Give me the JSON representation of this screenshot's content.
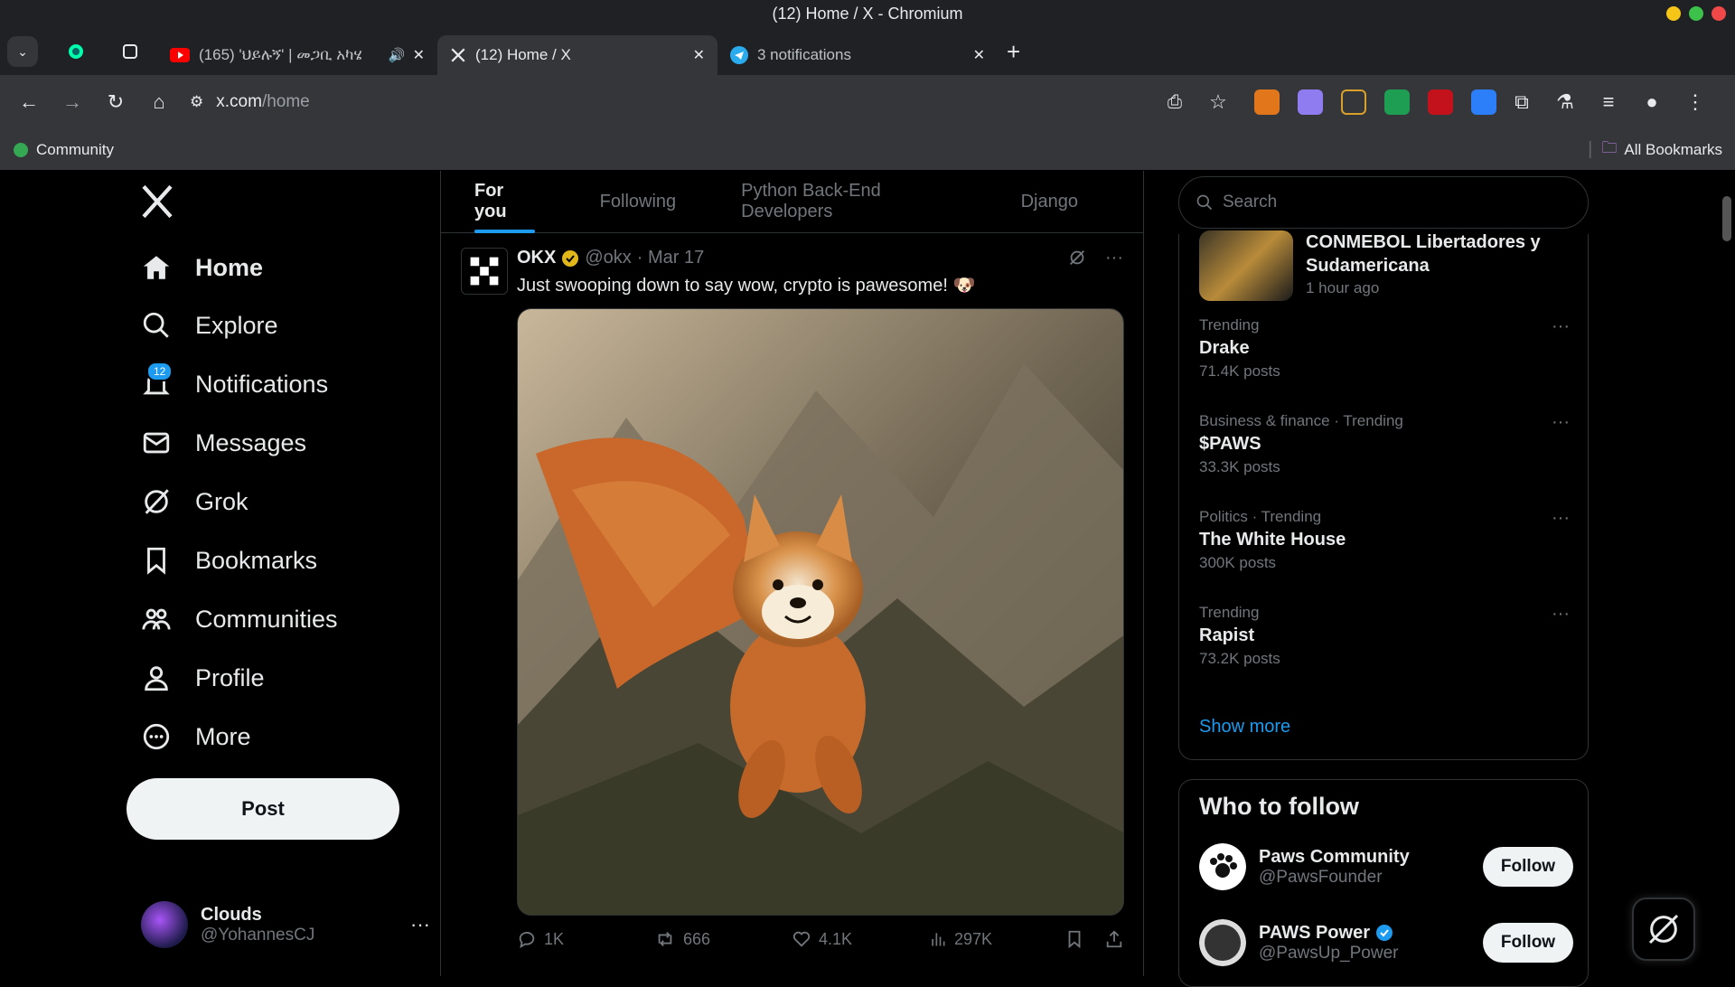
{
  "window": {
    "title": "(12) Home / X - Chromium"
  },
  "tabs": [
    {
      "title": "(165) 'ህይሉኝ' | መጋቢ አካሄ",
      "icon": "youtube-icon"
    },
    {
      "title": "(12) Home / X",
      "icon": "x-icon"
    },
    {
      "title": "3 notifications",
      "icon": "telegram-icon"
    }
  ],
  "address": {
    "host": "x.com",
    "path": "/home"
  },
  "bookmarks": {
    "item1": "Community",
    "all": "All Bookmarks"
  },
  "nav": {
    "home": "Home",
    "explore": "Explore",
    "notifications": "Notifications",
    "notifications_badge": "12",
    "messages": "Messages",
    "grok": "Grok",
    "bookmarks": "Bookmarks",
    "communities": "Communities",
    "profile": "Profile",
    "more": "More",
    "post": "Post"
  },
  "account": {
    "name": "Clouds",
    "handle": "@YohannesCJ",
    "more": "···"
  },
  "feed_tabs": [
    "For you",
    "Following",
    "Python Back-End Developers",
    "Django"
  ],
  "tweet": {
    "name": "OKX",
    "handle": "@okx",
    "date": "· Mar 17",
    "text": "Just swooping down to say wow, crypto is pawesome! 🐶",
    "more": "···",
    "replies": "1K",
    "retweets": "666",
    "likes": "4.1K",
    "views": "297K"
  },
  "search": {
    "placeholder": "Search"
  },
  "news": {
    "title": "CONMEBOL Libertadores y Sudamericana",
    "time": "1 hour ago"
  },
  "trends": [
    {
      "category": "Trending",
      "name": "Drake",
      "count": "71.4K posts"
    },
    {
      "category": "Business & finance · Trending",
      "name": "$PAWS",
      "count": "33.3K posts"
    },
    {
      "category": "Politics · Trending",
      "name": "The White House",
      "count": "300K posts"
    },
    {
      "category": "Trending",
      "name": "Rapist",
      "count": "73.2K posts"
    }
  ],
  "trends_more": "···",
  "show_more": "Show more",
  "who_to_follow": {
    "title": "Who to follow",
    "accounts": [
      {
        "name": "Paws Community",
        "handle": "@PawsFounder",
        "button": "Follow"
      },
      {
        "name": "PAWS Power",
        "handle": "@PawsUp_Power",
        "button": "Follow"
      }
    ]
  },
  "colors": {
    "accent": "#1d9bf0",
    "bg": "#000000",
    "border": "#2f3336",
    "muted": "#71767b"
  }
}
